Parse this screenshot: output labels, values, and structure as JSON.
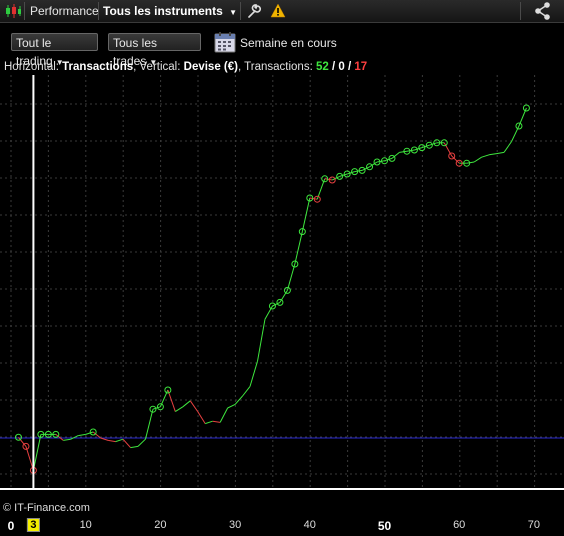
{
  "topbar": {
    "tab_performance": "Performance",
    "instrument_select": "Tous les instruments",
    "icons": [
      "candles-icon",
      "wrench-icon",
      "warning-icon",
      "share-icon"
    ]
  },
  "toolbar": {
    "trading_filter": "Tout le trading",
    "trades_filter": "Tous les trades",
    "period_label": "Semaine en cours",
    "calendar_icon": "calendar-icon"
  },
  "info": {
    "horizontal_label": "Horizontal:",
    "horizontal_value": "Transactions",
    "vertical_label": "Vertical:",
    "vertical_value": "Devise (€)",
    "transactions_label": "Transactions:",
    "count_green": "52",
    "count_neutral": "0",
    "count_red": "17",
    "sep": "/"
  },
  "watermark": "© IT-Finance.com",
  "colors": {
    "win": "#3ee83e",
    "loss": "#e84040",
    "baseline": "#2828d0",
    "grid": "#3a3a3a",
    "cursor": "#ffffff",
    "selected_tick_bg": "#f4f000"
  },
  "chart_data": {
    "type": "line",
    "x_axis": "Transactions",
    "y_axis": "Devise (€)",
    "xlim": [
      0,
      70
    ],
    "ylim": [
      -40,
      280
    ],
    "x_ticks": [
      "0",
      "3",
      "10",
      "20",
      "30",
      "40",
      "50",
      "60",
      "70"
    ],
    "bold_ticks": [
      "0",
      "50"
    ],
    "selected_tick": "3",
    "cursor_x": 3,
    "baseline_y": 0,
    "points": [
      [
        1,
        0.6
      ],
      [
        2,
        -7
      ],
      [
        3,
        -27
      ],
      [
        4,
        3
      ],
      [
        5,
        3
      ],
      [
        6,
        3
      ],
      [
        7,
        -2
      ],
      [
        8,
        -1
      ],
      [
        9,
        2
      ],
      [
        10,
        3
      ],
      [
        11,
        5
      ],
      [
        12,
        0
      ],
      [
        13,
        -2
      ],
      [
        14,
        -3
      ],
      [
        15,
        -1
      ],
      [
        16,
        -8
      ],
      [
        17,
        -7
      ],
      [
        18,
        -1
      ],
      [
        19,
        24
      ],
      [
        20,
        26
      ],
      [
        21,
        40
      ],
      [
        22,
        22
      ],
      [
        23,
        26
      ],
      [
        24,
        31
      ],
      [
        25,
        22
      ],
      [
        26,
        12
      ],
      [
        27,
        14
      ],
      [
        28,
        13
      ],
      [
        29,
        25
      ],
      [
        30,
        28
      ],
      [
        31,
        35
      ],
      [
        32,
        43
      ],
      [
        33,
        64
      ],
      [
        34,
        99
      ],
      [
        35,
        110
      ],
      [
        36,
        113
      ],
      [
        37,
        123
      ],
      [
        38,
        145
      ],
      [
        39,
        172
      ],
      [
        40,
        200
      ],
      [
        41,
        199
      ],
      [
        42,
        216
      ],
      [
        43,
        215
      ],
      [
        44,
        218
      ],
      [
        45,
        220
      ],
      [
        46,
        222
      ],
      [
        47,
        223
      ],
      [
        48,
        226
      ],
      [
        49,
        230
      ],
      [
        50,
        231
      ],
      [
        51,
        233
      ],
      [
        52,
        238
      ],
      [
        53,
        239
      ],
      [
        54,
        240
      ],
      [
        55,
        242
      ],
      [
        56,
        244
      ],
      [
        57,
        246
      ],
      [
        58,
        246
      ],
      [
        59,
        235
      ],
      [
        60,
        229
      ],
      [
        61,
        229
      ],
      [
        62,
        230
      ],
      [
        63,
        234
      ],
      [
        64,
        236
      ],
      [
        65,
        237
      ],
      [
        66,
        238
      ],
      [
        67,
        247
      ],
      [
        68,
        260
      ],
      [
        69,
        275
      ]
    ],
    "marked_points": [
      1,
      2,
      3,
      4,
      5,
      6,
      11,
      19,
      20,
      21,
      35,
      36,
      37,
      38,
      39,
      40,
      41,
      42,
      43,
      44,
      45,
      46,
      47,
      48,
      49,
      50,
      51,
      53,
      54,
      55,
      56,
      57,
      58,
      59,
      60,
      61,
      68,
      69
    ]
  }
}
